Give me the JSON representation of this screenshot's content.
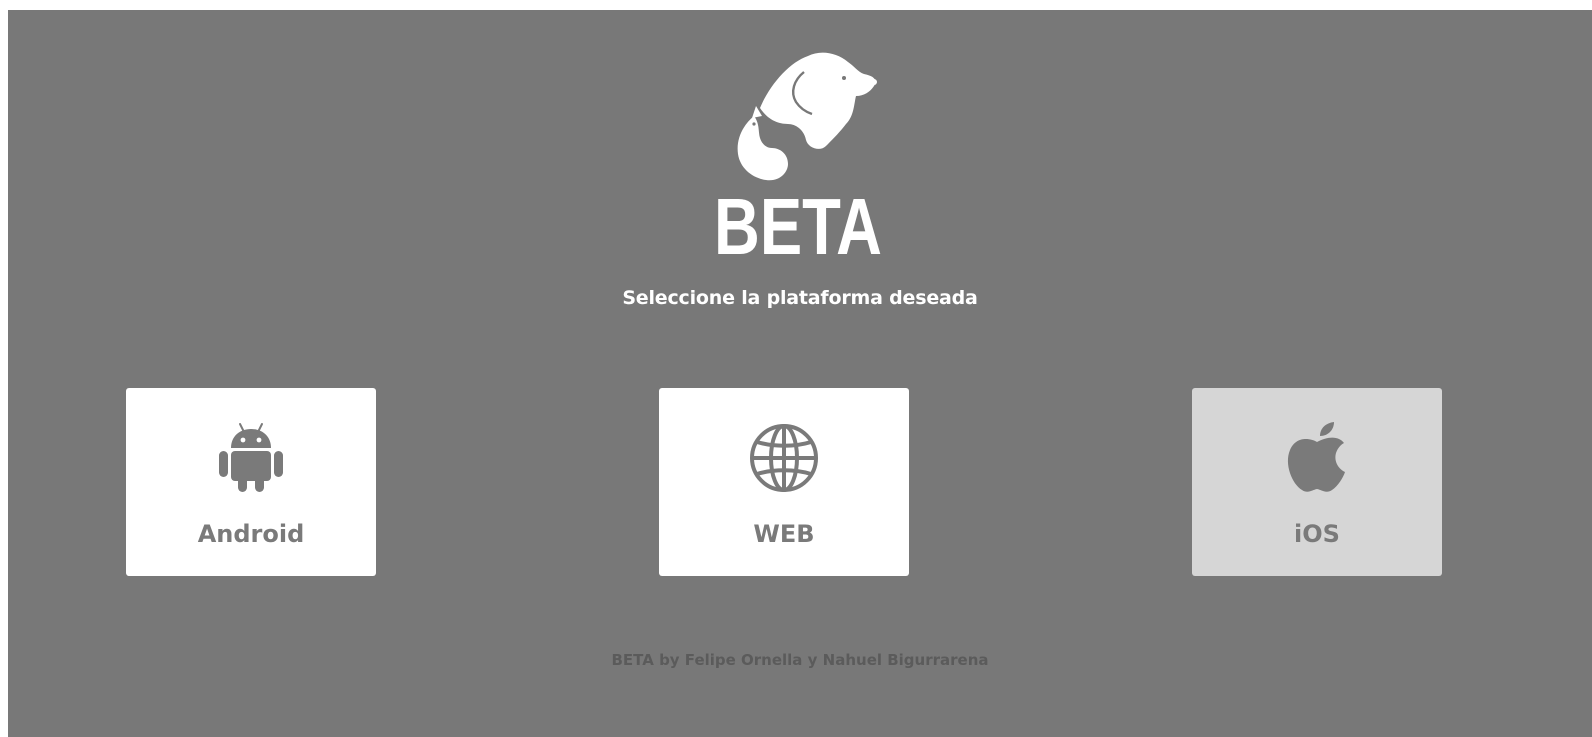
{
  "brand": {
    "name": "BETA",
    "logo_icon": "dog-cat-logo-icon"
  },
  "header": {
    "subtitle": "Seleccione la plataforma deseada"
  },
  "platforms": [
    {
      "label": "Android",
      "icon": "android-icon",
      "enabled": true
    },
    {
      "label": "WEB",
      "icon": "globe-icon",
      "enabled": true
    },
    {
      "label": "iOS",
      "icon": "apple-icon",
      "enabled": false
    }
  ],
  "footer": {
    "credit": "BETA by Felipe Ornella y Nahuel Bigurrarena"
  },
  "colors": {
    "background": "#787878",
    "card": "#ffffff",
    "card_disabled": "#d6d6d6",
    "icon": "#7a7a7a",
    "text_light": "#ffffff",
    "footer_text": "#5b5b5b"
  }
}
